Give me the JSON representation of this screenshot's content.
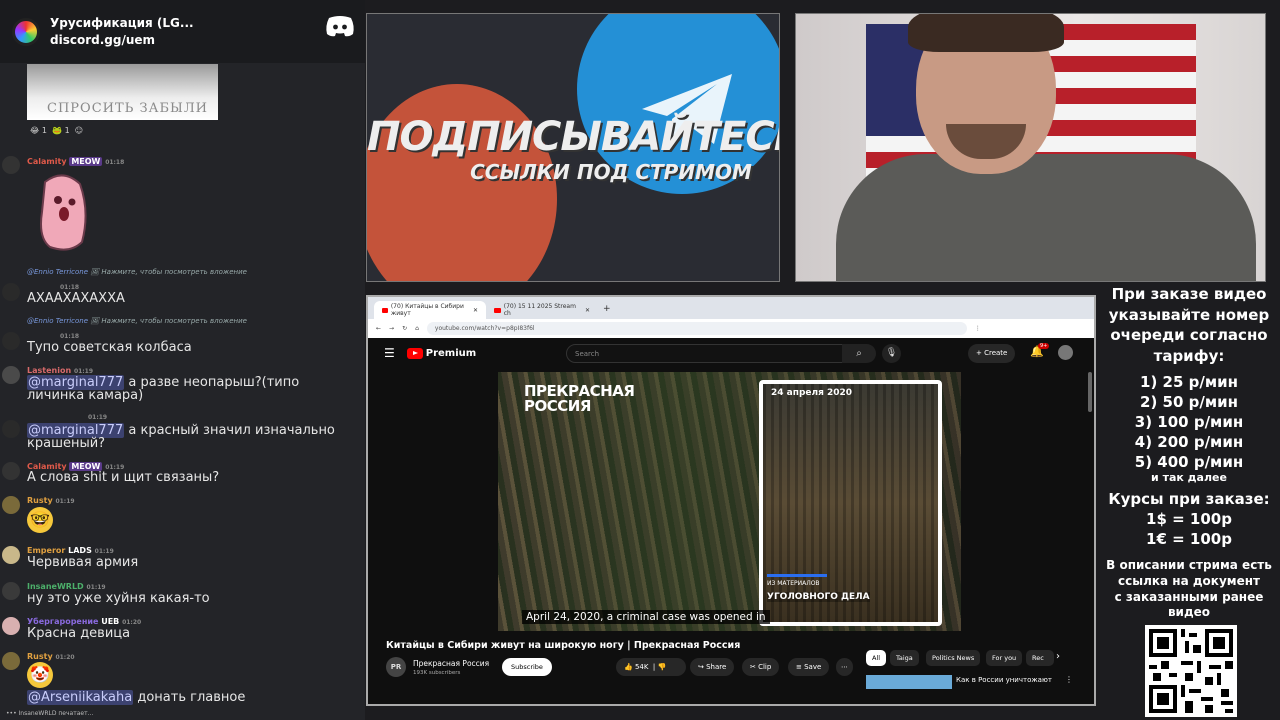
{
  "discord": {
    "server": "Урусификация (LG...",
    "invite": "discord.gg/uem"
  },
  "chat": {
    "image_text": "СПРОСИТЬ ЗАБЫЛИ",
    "reactions": [
      "1",
      "1"
    ],
    "messages": [
      {
        "user": "Calamity",
        "badge": "MEOW",
        "time": "01:18"
      },
      {
        "reply_user": "@Ennio Terricone",
        "reply_text": "Нажмите, чтобы посмотреть вложение",
        "time": "01:18",
        "text": "АХААХАХАХХА"
      },
      {
        "reply_user": "@Ennio Terricone",
        "reply_text": "Нажмите, чтобы посмотреть вложение",
        "time": "01:18",
        "text": "Тупо советская колбаса"
      },
      {
        "user": "Lastenion",
        "time": "01:19",
        "mention": "@marginal777",
        "text": " а разве неопарыш?(типо личинка камара)"
      },
      {
        "time": "01:19",
        "mention": "@marginal777",
        "text": " а красный значил изначально крашеный?"
      },
      {
        "user": "Calamity",
        "badge": "MEOW",
        "time": "01:19",
        "text": "А слова shit и щит связаны?"
      },
      {
        "user": "Rusty",
        "time": "01:19"
      },
      {
        "user": "Emperor",
        "badge": "LADS",
        "time": "01:19",
        "text": "Червивая армия"
      },
      {
        "user": "InsaneWRLD",
        "time": "01:19",
        "text": "ну это уже хуйня какая-то"
      },
      {
        "user": "Убергарорение",
        "badge": "UEB",
        "time": "01:20",
        "text": "Красна девица"
      },
      {
        "user": "Rusty",
        "time": "01:20",
        "mention": "@Arseniikakaha",
        "text": " донать главное"
      }
    ],
    "typing": "InsaneWRLD печатает..."
  },
  "promo": {
    "line1": "ПОДПИСЫВАЙТЕСЬ",
    "line2": "ССЫЛКИ ПОД СТРИМОМ"
  },
  "browser": {
    "tab1": "(70) Китайцы в Сибири живут",
    "tab2": "(70) 15 11 2025 Stream ch",
    "url": "youtube.com/watch?v=p8pI83f6l",
    "search_placeholder": "Search",
    "premium": "Premium",
    "create": "Create",
    "notif_count": "9+",
    "video": {
      "brand": "ПРЕКРАСНАЯ РОССИЯ",
      "date": "24 апреля 2020",
      "mat": "ИЗ МАТЕРИАЛОВ",
      "case": "УГОЛОВНОГО ДЕЛА",
      "caption": "April 24, 2020, a criminal case was opened in"
    },
    "title": "Китайцы в Сибири живут на широкую ногу | Прекрасная Россия",
    "channel": {
      "avatar": "PR",
      "name": "Прекрасная Россия",
      "subs": "193K subscribers",
      "subscribe": "Subscribe"
    },
    "actions": {
      "likes": "54K",
      "share": "Share",
      "clip": "Clip",
      "save": "Save"
    },
    "chips": [
      "All",
      "Taiga",
      "Politics News",
      "For you",
      "Rec"
    ],
    "rec_title": "Как в России уничтожают"
  },
  "prices": {
    "header": [
      "При заказе видео",
      "указывайте номер",
      "очереди согласно",
      "тарифу:"
    ],
    "tiers": [
      "1) 25 р/мин",
      "2) 50 р/мин",
      "3) 100 р/мин",
      "4) 200 р/мин",
      "5) 400 р/мин"
    ],
    "etc": "и так далее",
    "rates_header": "Курсы при заказе:",
    "rates": [
      "1$ = 100р",
      "1€ = 100р"
    ],
    "note": [
      "В описании стрима есть",
      "ссылка на документ",
      "с заказанными ранее",
      "видео"
    ]
  }
}
